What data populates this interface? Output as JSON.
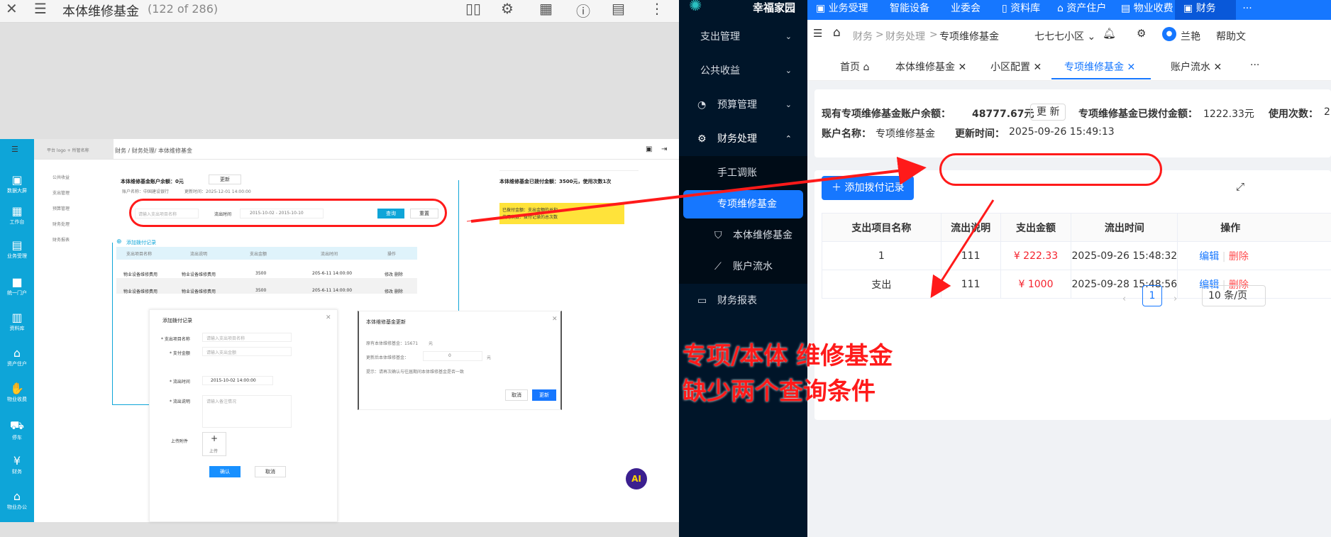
{
  "viewer": {
    "title": "本体维修基金",
    "count": "(122 of 286)"
  },
  "doc": {
    "brand": "平台 logo + 所管名称",
    "breadcrumb": "财务 / 财务处理/ 本体维修基金",
    "side_items": [
      "数据大屏",
      "工作台",
      "业务受理",
      "统一门户",
      "资料库",
      "资产住户",
      "物业收费",
      "停车",
      "财务",
      "物业办公"
    ],
    "menu": [
      "公共收益",
      "支出管理",
      "预算管理",
      "财务处理",
      "财务报表"
    ],
    "balance": "本体维修基金账户余额：0元",
    "update": "更新",
    "account": "账户名称：中国建设银行",
    "update_time": "更新时间：2025-12-01 14:00:00",
    "paid": "本体维修基金已拨付金额：3500元，使用次数1次",
    "search_ph": "请输入支出项目名称",
    "time_label": "流出时间",
    "date_range": "2015-10-02 - 2015-10-10",
    "query": "查询",
    "reset": "重置",
    "note1": "已拨付金额：支出金额的总和",
    "note2": "使用次数：拨付记录的总次数",
    "add": "添加拨付记录",
    "headers": [
      "支出项目名称",
      "流出说明",
      "支出金额",
      "流出时间",
      "操作"
    ],
    "rows": [
      [
        "物业设备维修费用",
        "物业设备维修费用",
        "3500",
        "205-6-11 14:00:00",
        "修改 删除"
      ],
      [
        "物业设备维修费用",
        "物业设备维修费用",
        "3500",
        "205-6-11 14:00:00",
        "修改 删除"
      ]
    ],
    "dlg1": {
      "title": "添加拨付记录",
      "f1": "* 支出项目名称",
      "p1": "请输入支出项目名称",
      "f2": "* 支付金额",
      "p2": "请输入支出金额",
      "f3": "* 流出时间",
      "v3": "2015-10-02 14:00:00",
      "f4": "* 流出说明",
      "p4": "请输入备注情况",
      "f5": "上传附件",
      "upload": "上传",
      "ok": "确认",
      "cancel": "取消"
    },
    "dlg2": {
      "title": "本体维修基金更新",
      "l1": "原有本体维修基金：15671",
      "unit1": "元",
      "l2": "更新后本体维修基金：",
      "v2": "0",
      "unit2": "元",
      "tip": "提示：请再次确认与往届期间本体维修基金是否一致",
      "cancel": "取消",
      "ok": "更新"
    }
  },
  "app": {
    "logo": "幸福家园",
    "top_nav": [
      "业务受理",
      "智能设备",
      "业委会",
      "资料库",
      "资产住户",
      "物业收费",
      "财务"
    ],
    "side": [
      {
        "label": "支出管理"
      },
      {
        "label": "公共收益"
      },
      {
        "label": "预算管理"
      },
      {
        "label": "财务处理"
      },
      {
        "label": "手工调账"
      },
      {
        "label": "专项维修基金"
      },
      {
        "label": "本体维修基金"
      },
      {
        "label": "账户流水"
      },
      {
        "label": "财务报表"
      }
    ],
    "breadcrumb": [
      "财务",
      "财务处理",
      "专项维修基金"
    ],
    "community": "七七七小区",
    "user": "兰艳",
    "help": "帮助文",
    "tabs": [
      "首页",
      "本体维修基金",
      "小区配置",
      "专项维修基金",
      "账户流水"
    ],
    "balance_label": "现有专项维修基金账户余额：",
    "balance_value": "48777.67元",
    "update_btn": "更 新",
    "paid_label": "专项维修基金已拨付金额：",
    "paid_value": "1222.33元",
    "use_label": "使用次数：",
    "use_value": "2",
    "account_label": "账户名称：",
    "account_value": "专项维修基金",
    "time_label": "更新时间：",
    "time_value": "2025-09-26 15:49:13",
    "add_btn": "添加拨付记录",
    "headers": [
      "支出项目名称",
      "流出说明",
      "支出金额",
      "流出时间",
      "操作"
    ],
    "rows": [
      {
        "name": "1",
        "desc": "111",
        "amount": "¥ 222.33",
        "time": "2025-09-26 15:48:32"
      },
      {
        "name": "支出",
        "desc": "111",
        "amount": "¥ 1000",
        "time": "2025-09-28 15:48:56"
      }
    ],
    "edit": "编辑",
    "delete": "删除",
    "page": "1",
    "page_size": "10 条/页"
  },
  "annotation": {
    "line1": "专项/本体 维修基金",
    "line2": "缺少两个查询条件",
    "color": "#ff1a1a"
  }
}
